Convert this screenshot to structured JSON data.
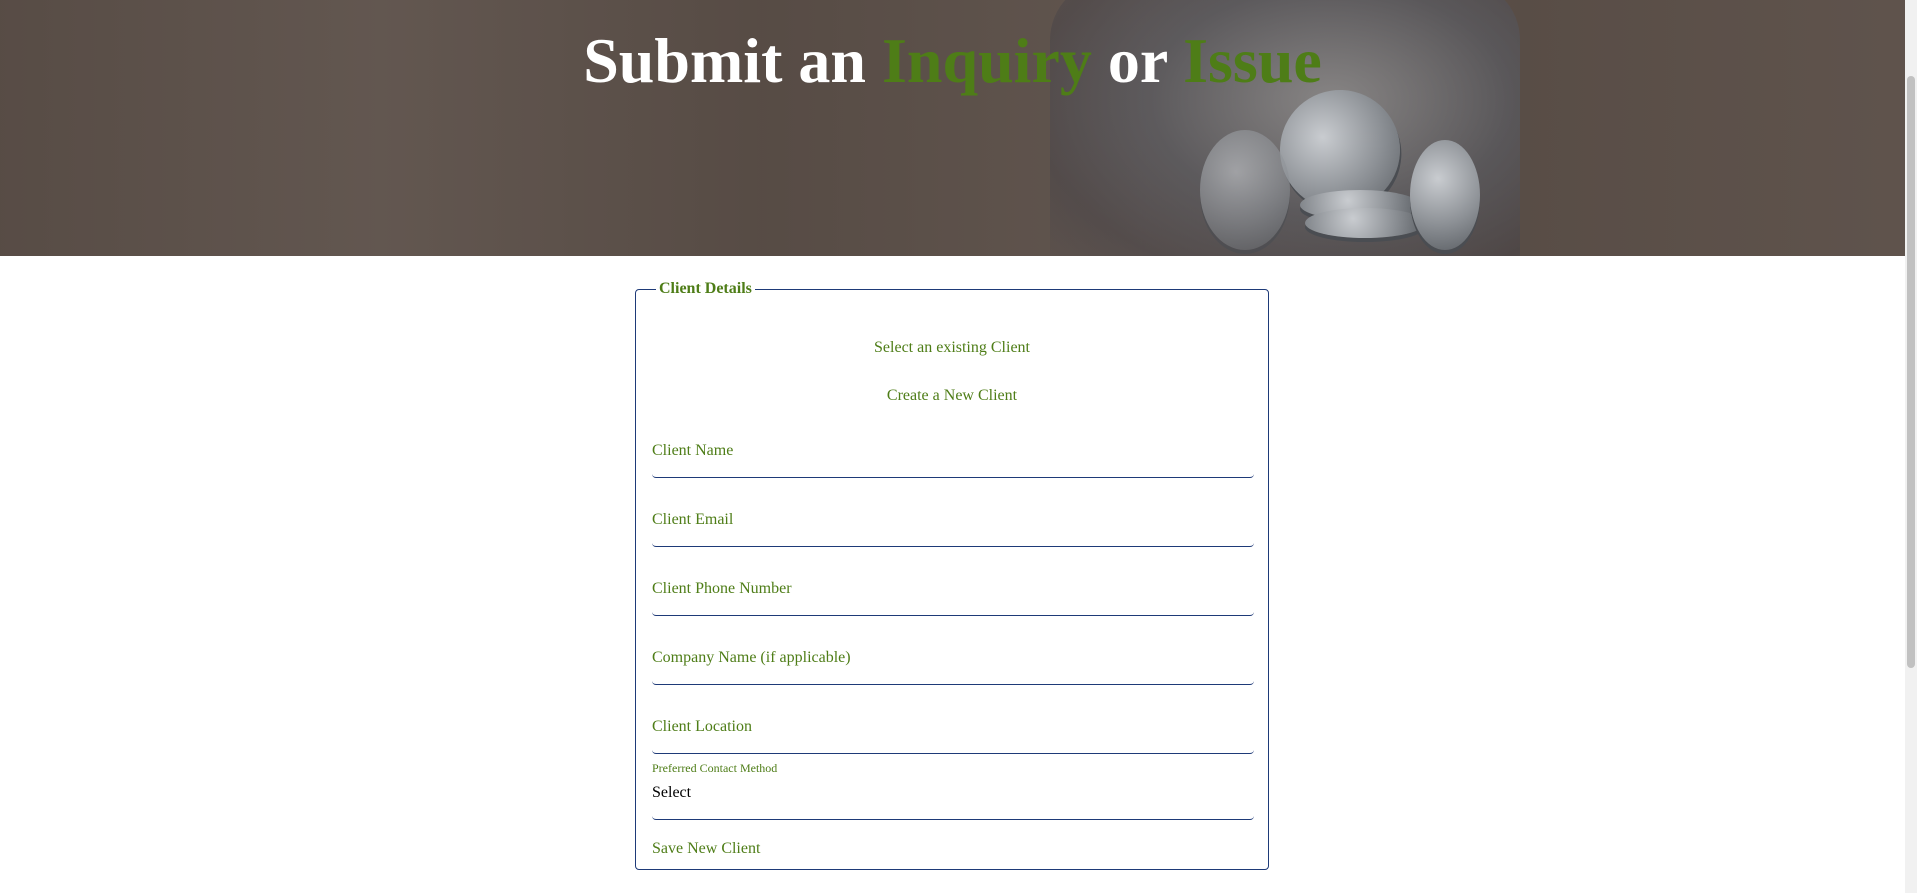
{
  "hero": {
    "title_part1": "Submit an ",
    "title_accent1": "Inquiry",
    "title_part2": " or ",
    "title_accent2": "Issue"
  },
  "client_details": {
    "legend": "Client Details",
    "select_existing_link": "Select an existing Client",
    "create_new_link": "Create a New Client",
    "fields": [
      {
        "placeholder": "Client Name"
      },
      {
        "placeholder": "Client Email"
      },
      {
        "placeholder": "Client Phone Number"
      },
      {
        "placeholder": "Company Name (if applicable)"
      },
      {
        "placeholder": "Client Location"
      }
    ],
    "contact_method": {
      "label": "Preferred Contact Method",
      "selected": "Select"
    },
    "save_button": "Save New Client"
  },
  "colors": {
    "accent_green": "#4e7d17",
    "border_navy": "#1e3a78"
  }
}
